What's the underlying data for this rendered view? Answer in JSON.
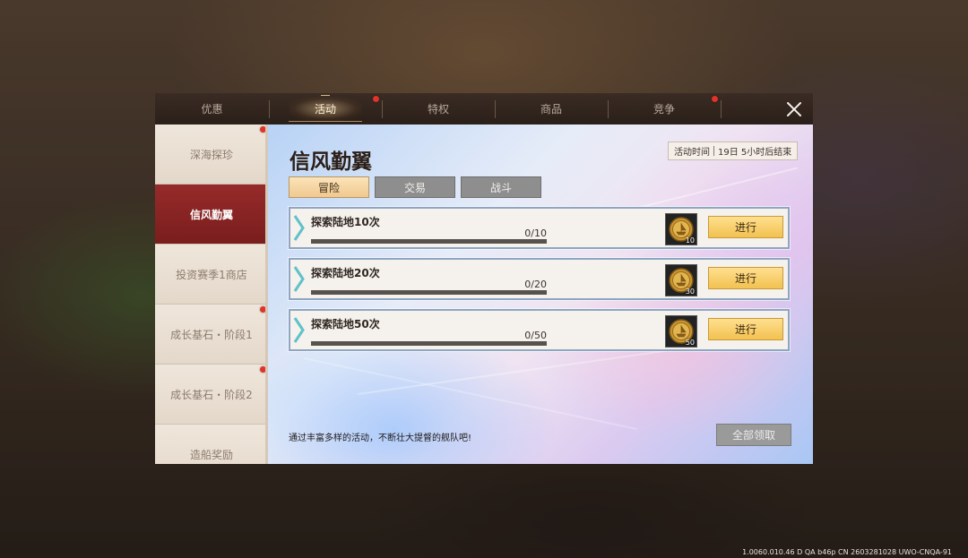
{
  "tabs": [
    {
      "label": "优惠",
      "active": false,
      "badge": false
    },
    {
      "label": "活动",
      "active": true,
      "badge": true
    },
    {
      "label": "特权",
      "active": false,
      "badge": false
    },
    {
      "label": "商品",
      "active": false,
      "badge": false
    },
    {
      "label": "竞争",
      "active": false,
      "badge": true
    }
  ],
  "sidebar": {
    "items": [
      {
        "label": "深海探珍",
        "active": false,
        "badge": true
      },
      {
        "label": "信风勤翼",
        "active": true,
        "badge": false
      },
      {
        "label": "投资赛季1商店",
        "active": false,
        "badge": false
      },
      {
        "label": "成长基石・阶段1",
        "active": false,
        "badge": true
      },
      {
        "label": "成长基石・阶段2",
        "active": false,
        "badge": true
      },
      {
        "label": "造船奖励",
        "active": false,
        "badge": false
      }
    ]
  },
  "main": {
    "title": "信风勤翼",
    "time_label": "活动时间",
    "time_value": "19日 5小时后结束",
    "subtabs": [
      {
        "label": "冒险",
        "active": true
      },
      {
        "label": "交易",
        "active": false
      },
      {
        "label": "战斗",
        "active": false
      }
    ],
    "tasks": [
      {
        "name": "探索陆地10次",
        "progress_text": "0/10",
        "progress": 0,
        "reward_qty": "10",
        "button_label": "进行"
      },
      {
        "name": "探索陆地20次",
        "progress_text": "0/20",
        "progress": 0,
        "reward_qty": "30",
        "button_label": "进行"
      },
      {
        "name": "探索陆地50次",
        "progress_text": "0/50",
        "progress": 0,
        "reward_qty": "50",
        "button_label": "进行"
      }
    ],
    "footer_text": "通过丰富多样的活动，不断壮大提督的舰队吧!",
    "claim_all_label": "全部领取"
  },
  "version_text": "1.0060.010.46 D QA b46p CN 2603281028 UWO-CNQA-91",
  "colors": {
    "active_side": "#8a2424",
    "accent_button": "#f2c150",
    "badge": "#e0342a"
  },
  "icons": {
    "close": "close-icon",
    "reward": "gold-coin-icon",
    "chevron": "chevron-right-icon"
  }
}
